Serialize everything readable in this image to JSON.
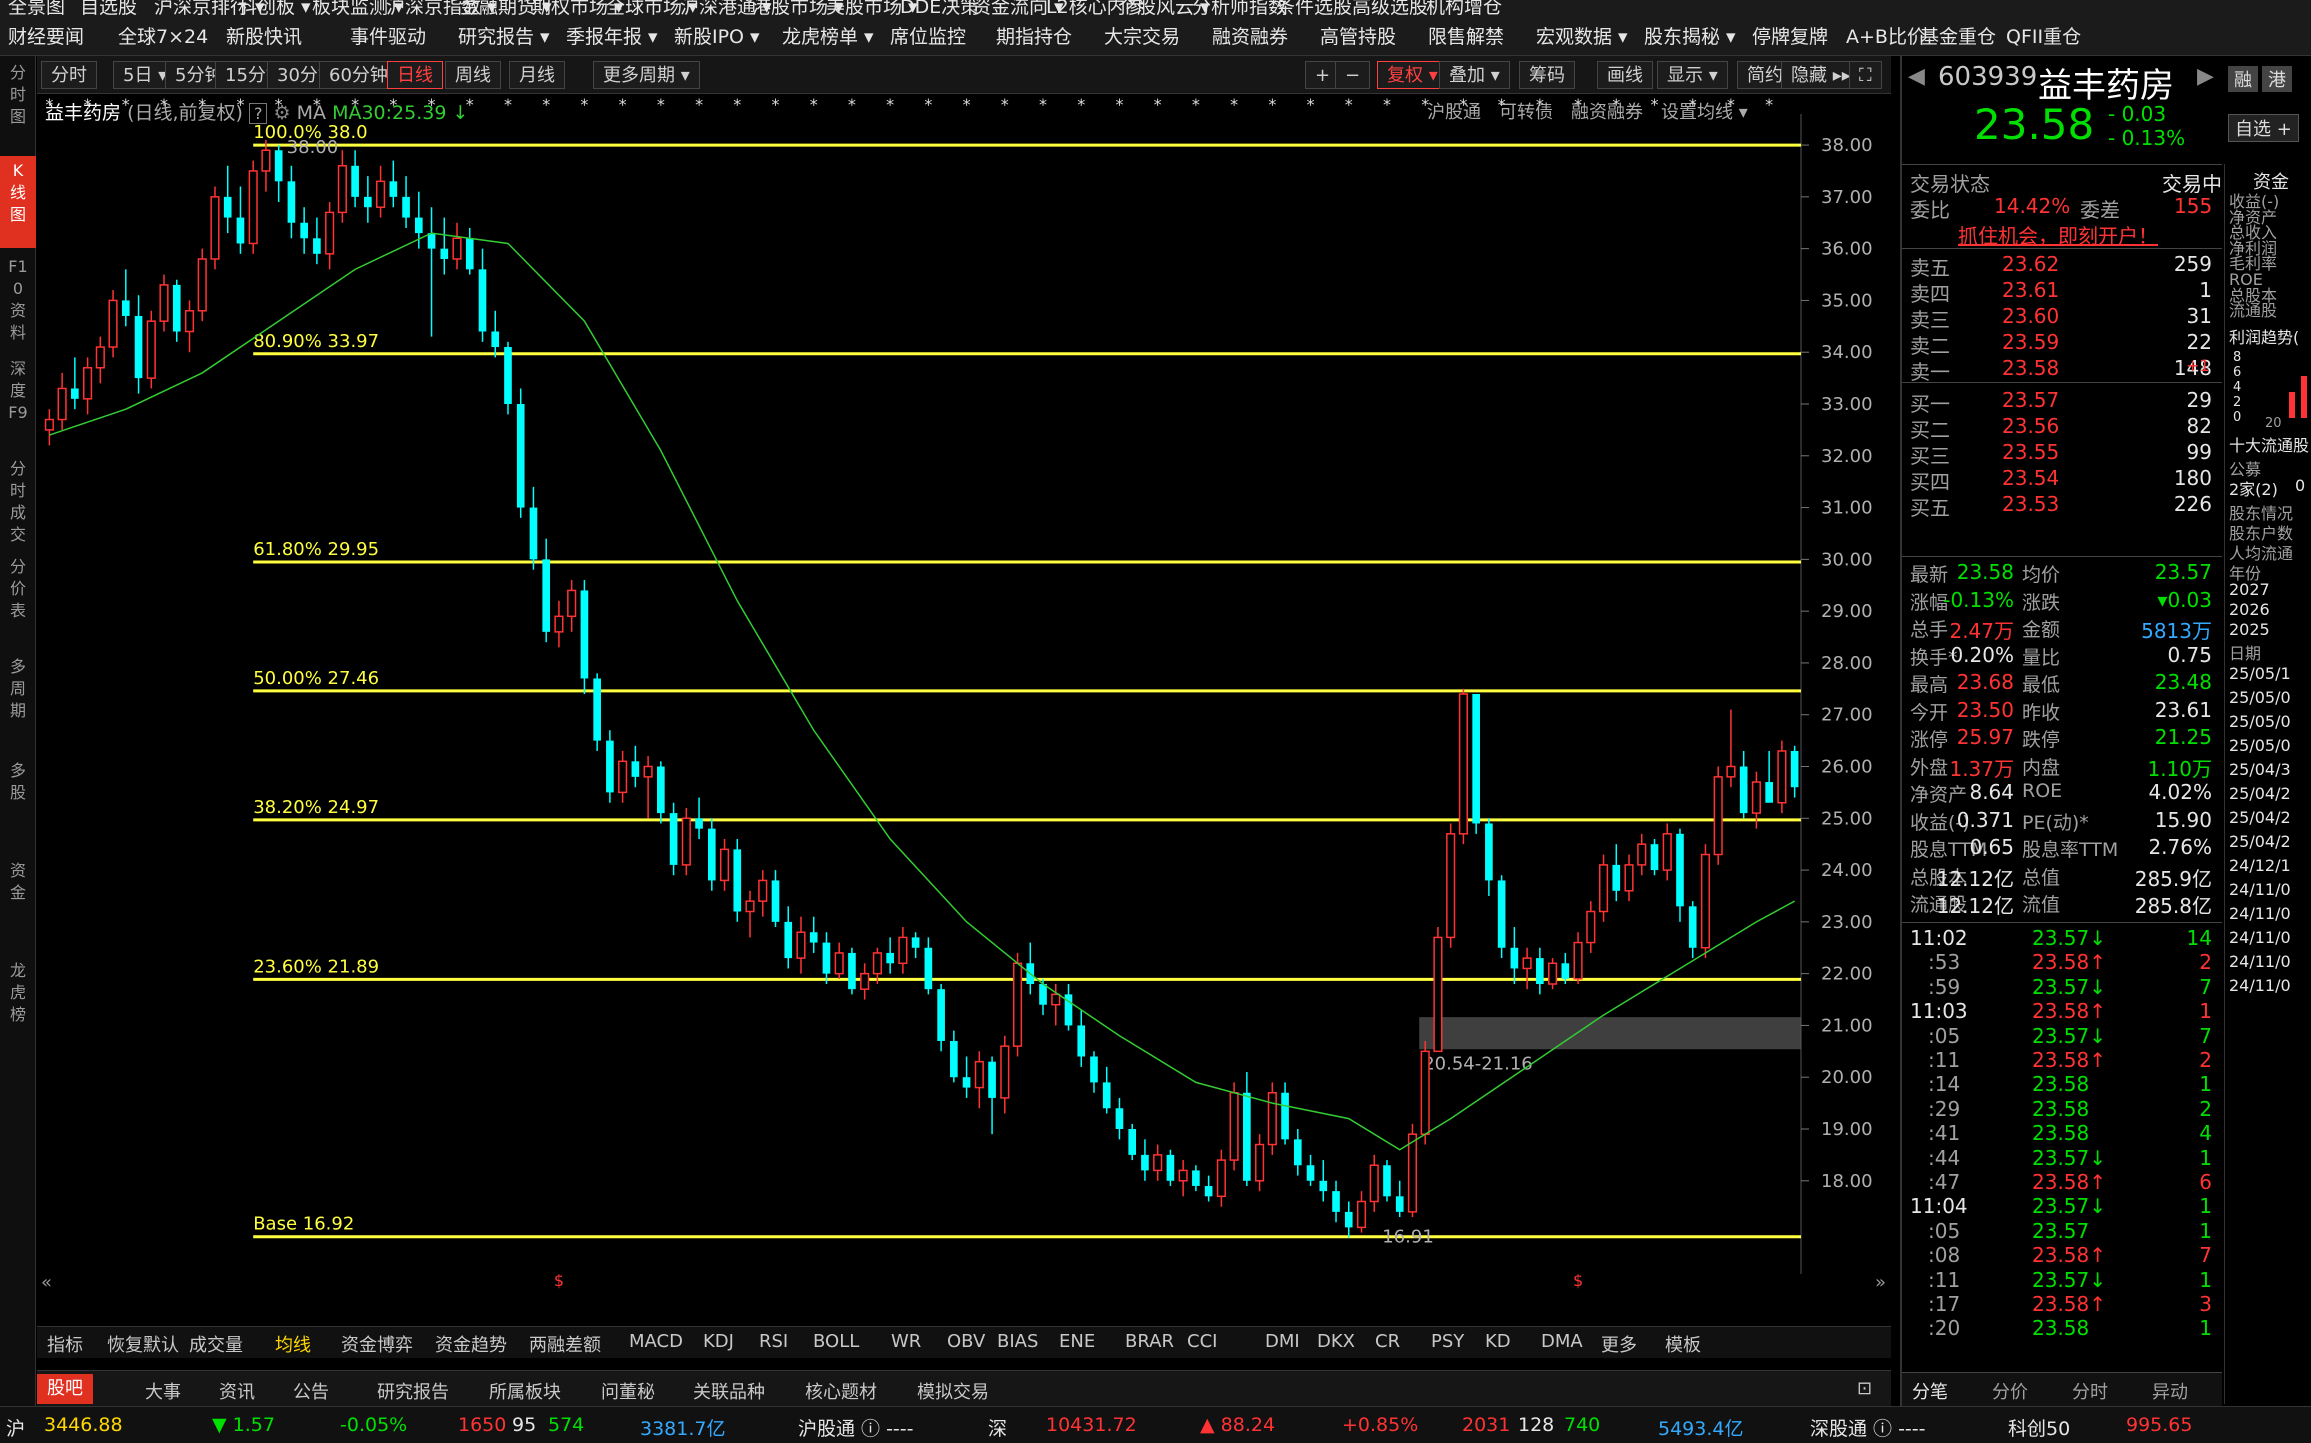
{
  "topnav": {
    "row1": [
      "全景图",
      "自选股",
      "沪深京排行 ▾",
      "科创板 ▾",
      "板块监测 ▾",
      "沪深京指数 ▾",
      "金融期货 ▾",
      "期权市场 ▾",
      "全球市场 ▾",
      "沪深港通 ▾",
      "港股市场 ▾",
      "美股市场 ▾",
      "DDE决策",
      "资金流向 ▾",
      "L2核心内参",
      "个股风云 ▾",
      "分析师指数",
      "条件选股",
      "高级选股",
      "机构增仓"
    ],
    "row2": [
      "财经要闻",
      "全球7×24",
      "新股快讯",
      "事件驱动",
      "研究报告 ▾",
      "季报年报 ▾",
      "新股IPO ▾",
      "龙虎榜单 ▾",
      "席位监控",
      "期指持仓",
      "大宗交易",
      "融资融券",
      "高管持股",
      "限售解禁",
      "宏观数据 ▾",
      "股东揭秘 ▾",
      "停牌复牌",
      "A+B比价",
      "基金重仓",
      "QFII重仓"
    ]
  },
  "leftbar": [
    "分时图",
    "K线图",
    "F10资料",
    "深度F9",
    "分时成交",
    "分价表",
    "多周期",
    "多股",
    "资金",
    "龙虎榜"
  ],
  "toolbar": {
    "periods": [
      "分时",
      "5日 ▾",
      "5分钟",
      "15分钟",
      "30分钟",
      "60分钟",
      "日线",
      "周线",
      "月线",
      "更多周期 ▾"
    ],
    "active_period": "日线",
    "right": [
      "+",
      "−",
      "复权 ▾",
      "叠加 ▾",
      "筹码",
      "画线",
      "显示 ▾",
      "简约",
      "隐藏 ▸▸"
    ]
  },
  "chart_header": {
    "name": "益丰药房",
    "mode": "(日线,前复权)",
    "help": "?",
    "ma_label": "MA",
    "ma30": "MA30:25.39 ↓",
    "links": [
      "沪股通",
      "可转债",
      "融资融券",
      "设置均线 ▾"
    ]
  },
  "chart_data": {
    "type": "candlestick",
    "y_ticks": [
      "38.00",
      "37.00",
      "36.00",
      "35.00",
      "34.00",
      "33.00",
      "32.00",
      "31.00",
      "30.00",
      "29.00",
      "28.00",
      "27.00",
      "26.00",
      "25.00",
      "24.00",
      "23.00",
      "22.00",
      "21.00",
      "20.00",
      "19.00",
      "18.00"
    ],
    "ylim": [
      16.2,
      38.6
    ],
    "fib_levels": [
      {
        "label": "100.0% 38.0",
        "value": 38.0
      },
      {
        "label": "80.90% 33.97",
        "value": 33.97
      },
      {
        "label": "61.80% 29.95",
        "value": 29.95
      },
      {
        "label": "50.00% 27.46",
        "value": 27.46
      },
      {
        "label": "38.20% 24.97",
        "value": 24.97
      },
      {
        "label": "23.60% 21.89",
        "value": 21.89
      },
      {
        "label": "Base   16.92",
        "value": 16.92
      }
    ],
    "peak_label": "38.00",
    "trough_label": "16.91",
    "zone_label": "20.54-21.16",
    "zone": [
      20.54,
      21.16
    ],
    "candles": [
      [
        32.5,
        32.9,
        32.2,
        32.7
      ],
      [
        32.7,
        33.6,
        32.5,
        33.3
      ],
      [
        33.3,
        33.9,
        32.9,
        33.1
      ],
      [
        33.1,
        33.9,
        32.8,
        33.7
      ],
      [
        33.7,
        34.3,
        33.4,
        34.1
      ],
      [
        34.1,
        35.2,
        33.9,
        35.0
      ],
      [
        35.0,
        35.6,
        34.5,
        34.7
      ],
      [
        34.7,
        35.1,
        33.2,
        33.5
      ],
      [
        33.5,
        34.8,
        33.3,
        34.6
      ],
      [
        34.6,
        35.5,
        34.4,
        35.3
      ],
      [
        35.3,
        35.4,
        34.2,
        34.4
      ],
      [
        34.4,
        35.0,
        34.0,
        34.8
      ],
      [
        34.8,
        36.0,
        34.6,
        35.8
      ],
      [
        35.8,
        37.2,
        35.6,
        37.0
      ],
      [
        37.0,
        37.6,
        36.3,
        36.6
      ],
      [
        36.6,
        37.2,
        35.9,
        36.1
      ],
      [
        36.1,
        37.7,
        35.9,
        37.5
      ],
      [
        37.5,
        38.1,
        37.1,
        37.9
      ],
      [
        37.9,
        38.0,
        36.9,
        37.3
      ],
      [
        37.3,
        37.6,
        36.2,
        36.5
      ],
      [
        36.5,
        36.8,
        35.9,
        36.2
      ],
      [
        36.2,
        36.6,
        35.7,
        35.9
      ],
      [
        35.9,
        36.9,
        35.6,
        36.7
      ],
      [
        36.7,
        37.9,
        36.5,
        37.6
      ],
      [
        37.6,
        37.9,
        36.8,
        37.0
      ],
      [
        37.0,
        37.4,
        36.5,
        36.8
      ],
      [
        36.8,
        37.6,
        36.6,
        37.3
      ],
      [
        37.3,
        37.7,
        36.8,
        37.0
      ],
      [
        37.0,
        37.4,
        36.4,
        36.6
      ],
      [
        36.6,
        37.1,
        36.0,
        36.3
      ],
      [
        36.3,
        36.8,
        34.3,
        36.0
      ],
      [
        36.0,
        36.6,
        35.5,
        35.8
      ],
      [
        35.8,
        36.5,
        35.6,
        36.2
      ],
      [
        36.2,
        36.4,
        35.5,
        35.6
      ],
      [
        35.6,
        36.0,
        34.2,
        34.4
      ],
      [
        34.4,
        34.8,
        33.9,
        34.1
      ],
      [
        34.1,
        34.2,
        32.8,
        33.0
      ],
      [
        33.0,
        33.3,
        30.8,
        31.0
      ],
      [
        31.0,
        31.4,
        29.8,
        30.0
      ],
      [
        30.0,
        30.4,
        28.4,
        28.6
      ],
      [
        28.6,
        29.2,
        28.3,
        28.9
      ],
      [
        28.9,
        29.6,
        28.6,
        29.4
      ],
      [
        29.4,
        29.6,
        27.4,
        27.7
      ],
      [
        27.7,
        27.8,
        26.3,
        26.5
      ],
      [
        26.5,
        26.7,
        25.3,
        25.5
      ],
      [
        25.5,
        26.3,
        25.3,
        26.1
      ],
      [
        26.1,
        26.4,
        25.6,
        25.8
      ],
      [
        25.8,
        26.2,
        25.0,
        26.0
      ],
      [
        26.0,
        26.1,
        24.9,
        25.1
      ],
      [
        25.1,
        25.3,
        23.9,
        24.1
      ],
      [
        24.1,
        25.2,
        23.9,
        25.0
      ],
      [
        25.0,
        25.4,
        24.6,
        24.8
      ],
      [
        24.8,
        25.0,
        23.6,
        23.8
      ],
      [
        23.8,
        24.6,
        23.6,
        24.4
      ],
      [
        24.4,
        24.6,
        23.0,
        23.2
      ],
      [
        23.2,
        23.6,
        22.7,
        23.4
      ],
      [
        23.4,
        24.0,
        23.1,
        23.8
      ],
      [
        23.8,
        24.0,
        22.9,
        23.0
      ],
      [
        23.0,
        23.3,
        22.1,
        22.3
      ],
      [
        22.3,
        23.1,
        22.0,
        22.8
      ],
      [
        22.8,
        23.1,
        22.4,
        22.6
      ],
      [
        22.6,
        22.8,
        21.8,
        22.0
      ],
      [
        22.0,
        22.6,
        21.9,
        22.4
      ],
      [
        22.4,
        22.5,
        21.6,
        21.7
      ],
      [
        21.7,
        22.2,
        21.5,
        22.0
      ],
      [
        22.0,
        22.5,
        21.8,
        22.4
      ],
      [
        22.4,
        22.7,
        22.0,
        22.2
      ],
      [
        22.2,
        22.9,
        22.0,
        22.7
      ],
      [
        22.7,
        22.8,
        22.3,
        22.5
      ],
      [
        22.5,
        22.7,
        21.6,
        21.7
      ],
      [
        21.7,
        21.8,
        20.5,
        20.7
      ],
      [
        20.7,
        20.9,
        19.9,
        20.0
      ],
      [
        20.0,
        20.4,
        19.6,
        19.8
      ],
      [
        19.8,
        20.5,
        19.4,
        20.3
      ],
      [
        20.3,
        20.4,
        18.9,
        19.6
      ],
      [
        19.6,
        20.8,
        19.3,
        20.6
      ],
      [
        20.6,
        22.4,
        20.4,
        22.2
      ],
      [
        22.2,
        22.6,
        21.6,
        21.8
      ],
      [
        21.8,
        21.9,
        21.2,
        21.4
      ],
      [
        21.4,
        21.8,
        21.0,
        21.6
      ],
      [
        21.6,
        21.8,
        20.9,
        21.0
      ],
      [
        21.0,
        21.3,
        20.2,
        20.4
      ],
      [
        20.4,
        20.5,
        19.7,
        19.9
      ],
      [
        19.9,
        20.2,
        19.3,
        19.4
      ],
      [
        19.4,
        19.6,
        18.8,
        19.0
      ],
      [
        19.0,
        19.1,
        18.4,
        18.5
      ],
      [
        18.5,
        18.8,
        18.0,
        18.2
      ],
      [
        18.2,
        18.7,
        18.0,
        18.5
      ],
      [
        18.5,
        18.6,
        17.9,
        18.0
      ],
      [
        18.0,
        18.4,
        17.7,
        18.2
      ],
      [
        18.2,
        18.3,
        17.8,
        17.9
      ],
      [
        17.9,
        18.1,
        17.6,
        17.7
      ],
      [
        17.7,
        18.6,
        17.5,
        18.4
      ],
      [
        18.4,
        19.9,
        18.2,
        19.7
      ],
      [
        19.7,
        20.1,
        17.9,
        18.0
      ],
      [
        18.0,
        18.9,
        17.8,
        18.7
      ],
      [
        18.7,
        19.9,
        18.5,
        19.7
      ],
      [
        19.7,
        19.9,
        18.7,
        18.8
      ],
      [
        18.8,
        19.0,
        18.1,
        18.3
      ],
      [
        18.3,
        18.5,
        17.9,
        18.0
      ],
      [
        18.0,
        18.4,
        17.6,
        17.8
      ],
      [
        17.8,
        18.0,
        17.2,
        17.4
      ],
      [
        17.4,
        17.6,
        16.9,
        17.1
      ],
      [
        17.1,
        17.8,
        17.0,
        17.6
      ],
      [
        17.6,
        18.5,
        17.4,
        18.3
      ],
      [
        18.3,
        18.4,
        17.6,
        17.7
      ],
      [
        17.7,
        18.0,
        17.3,
        17.4
      ],
      [
        17.4,
        19.1,
        17.3,
        18.9
      ],
      [
        18.9,
        20.7,
        18.7,
        20.5
      ],
      [
        20.5,
        22.9,
        20.5,
        22.7
      ],
      [
        22.7,
        24.9,
        22.5,
        24.7
      ],
      [
        24.7,
        27.5,
        24.5,
        27.4
      ],
      [
        27.4,
        27.4,
        24.7,
        24.9
      ],
      [
        24.9,
        25.0,
        23.5,
        23.8
      ],
      [
        23.8,
        23.9,
        22.3,
        22.5
      ],
      [
        22.5,
        22.9,
        21.8,
        22.1
      ],
      [
        22.1,
        22.5,
        21.7,
        22.3
      ],
      [
        22.3,
        22.5,
        21.6,
        21.8
      ],
      [
        21.8,
        22.3,
        21.7,
        22.2
      ],
      [
        22.2,
        22.4,
        21.8,
        21.9
      ],
      [
        21.9,
        22.8,
        21.8,
        22.6
      ],
      [
        22.6,
        23.4,
        22.4,
        23.2
      ],
      [
        23.2,
        24.3,
        23.0,
        24.1
      ],
      [
        24.1,
        24.5,
        23.4,
        23.6
      ],
      [
        23.6,
        24.3,
        23.4,
        24.1
      ],
      [
        24.1,
        24.7,
        23.9,
        24.5
      ],
      [
        24.5,
        24.6,
        23.9,
        24.0
      ],
      [
        24.0,
        24.9,
        23.8,
        24.7
      ],
      [
        24.7,
        24.8,
        23.0,
        23.3
      ],
      [
        23.3,
        23.4,
        22.3,
        22.5
      ],
      [
        22.5,
        24.5,
        22.3,
        24.3
      ],
      [
        24.3,
        26.0,
        24.1,
        25.8
      ],
      [
        25.8,
        27.1,
        25.6,
        26.0
      ],
      [
        26.0,
        26.3,
        25.0,
        25.1
      ],
      [
        25.1,
        25.9,
        24.8,
        25.7
      ],
      [
        25.7,
        26.3,
        25.4,
        25.3
      ],
      [
        25.3,
        26.5,
        25.1,
        26.3
      ],
      [
        26.3,
        26.4,
        25.4,
        25.6
      ]
    ],
    "ma30": [
      [
        0,
        32.4
      ],
      [
        6,
        32.9
      ],
      [
        12,
        33.6
      ],
      [
        18,
        34.6
      ],
      [
        24,
        35.6
      ],
      [
        30,
        36.3
      ],
      [
        36,
        36.1
      ],
      [
        42,
        34.6
      ],
      [
        48,
        32.1
      ],
      [
        54,
        29.2
      ],
      [
        60,
        26.7
      ],
      [
        66,
        24.6
      ],
      [
        72,
        23.0
      ],
      [
        78,
        21.8
      ],
      [
        84,
        20.8
      ],
      [
        90,
        19.9
      ],
      [
        96,
        19.5
      ],
      [
        102,
        19.2
      ],
      [
        106,
        18.6
      ],
      [
        110,
        19.2
      ],
      [
        116,
        20.2
      ],
      [
        122,
        21.2
      ],
      [
        128,
        22.1
      ],
      [
        134,
        23.0
      ],
      [
        137,
        23.4
      ]
    ]
  },
  "indicator_tabs": [
    "指标",
    "恢复默认",
    "成交量",
    "均线",
    "资金博弈",
    "资金趋势",
    "两融差额",
    "MACD",
    "KDJ",
    "RSI",
    "BOLL",
    "WR",
    "OBV",
    "BIAS",
    "ENE",
    "BRAR",
    "CCI",
    "DMI",
    "DKX",
    "CR",
    "PSY",
    "KD",
    "DMA",
    "更多",
    "模板"
  ],
  "news_tabs": [
    "股吧",
    "大事",
    "资讯",
    "公告",
    "研究报告",
    "所属板块",
    "问董秘",
    "关联品种",
    "核心题材",
    "模拟交易"
  ],
  "quote": {
    "code": "603939",
    "name": "益丰药房",
    "price": "23.58",
    "change": "- 0.03",
    "pct": "- 0.13%",
    "btn_rong": "融",
    "btn_gang": "港",
    "btn_add": "自选 +",
    "trade_state_label": "交易状态",
    "trade_state": "交易中",
    "weibi_label": "委比",
    "weibi": "14.42%",
    "weicha_label": "委差",
    "weicha": "155",
    "promo": "抓住机会，即刻开户！",
    "asks": [
      [
        "卖五",
        "23.62",
        "259"
      ],
      [
        "卖四",
        "23.61",
        "1"
      ],
      [
        "卖三",
        "23.60",
        "31"
      ],
      [
        "卖二",
        "23.59",
        "22"
      ],
      [
        "卖一",
        "23.58",
        "148"
      ]
    ],
    "ask_note": "+1",
    "bids": [
      [
        "买一",
        "23.57",
        "29"
      ],
      [
        "买二",
        "23.56",
        "82"
      ],
      [
        "买三",
        "23.55",
        "99"
      ],
      [
        "买四",
        "23.54",
        "180"
      ],
      [
        "买五",
        "23.53",
        "226"
      ]
    ],
    "stats": [
      [
        "最新",
        "23.58",
        "均价",
        "23.57"
      ],
      [
        "涨幅",
        "-0.13%",
        "涨跌",
        "▾0.03"
      ],
      [
        "总手",
        "2.47万",
        "金额",
        "5813万"
      ],
      [
        "换手*",
        "0.20%",
        "量比",
        "0.75"
      ],
      [
        "最高",
        "23.68",
        "最低",
        "23.48"
      ],
      [
        "今开",
        "23.50",
        "昨收",
        "23.61"
      ],
      [
        "涨停",
        "25.97",
        "跌停",
        "21.25"
      ],
      [
        "外盘",
        "1.37万",
        "内盘",
        "1.10万"
      ],
      [
        "净资产",
        "8.64",
        "ROE",
        "4.02%"
      ],
      [
        "收益(-)",
        "0.371",
        "PE(动)*",
        "15.90"
      ],
      [
        "股息TTM",
        "0.65",
        "股息率TTM",
        "2.76%"
      ],
      [
        "总股本",
        "12.12亿",
        "总值",
        "285.9亿"
      ],
      [
        "流通股",
        "12.12亿",
        "流值",
        "285.8亿"
      ]
    ],
    "ticks": [
      [
        "11:02",
        "23.57↓",
        "14"
      ],
      [
        ":53",
        "23.58↑",
        "2"
      ],
      [
        ":59",
        "23.57↓",
        "7"
      ],
      [
        "11:03",
        "23.58↑",
        "1"
      ],
      [
        ":05",
        "23.57↓",
        "7"
      ],
      [
        ":11",
        "23.58↑",
        "2"
      ],
      [
        ":14",
        "23.58",
        "1"
      ],
      [
        ":29",
        "23.58",
        "2"
      ],
      [
        ":41",
        "23.58",
        "4"
      ],
      [
        ":44",
        "23.57↓",
        "1"
      ],
      [
        ":47",
        "23.58↑",
        "6"
      ],
      [
        "11:04",
        "23.57↓",
        "1"
      ],
      [
        ":05",
        "23.57",
        "1"
      ],
      [
        ":08",
        "23.58↑",
        "7"
      ],
      [
        ":11",
        "23.57↓",
        "1"
      ],
      [
        ":17",
        "23.58↑",
        "3"
      ],
      [
        ":20",
        "23.58",
        "1"
      ]
    ],
    "tick_tabs": [
      "分笔",
      "分价",
      "分时",
      "异动"
    ],
    "side_header": "资金",
    "side_items": [
      "收益(-)",
      "净资产",
      "总收入",
      "净利润",
      "毛利率",
      "ROE",
      "总股本",
      "流通股"
    ],
    "side_trend": "利润趋势(",
    "side_chart_ticks": [
      "8",
      "6",
      "4",
      "2",
      "0"
    ],
    "side_chart_x": "20",
    "side_top10": "十大流通股",
    "side_gongmu": "公募",
    "side_jia": "2家(2)",
    "side_jia2": "0",
    "side_gudong": [
      "股东情况",
      "股东户数",
      "人均流通"
    ],
    "side_year_hdr": "年份",
    "side_years": [
      "2027",
      "2026",
      "2025"
    ],
    "side_date_hdr": "日期",
    "side_dates": [
      "25/05/1",
      "25/05/0",
      "25/05/0",
      "25/05/0",
      "25/04/3",
      "25/04/2",
      "25/04/2",
      "25/04/2",
      "24/12/1",
      "24/11/0",
      "24/11/0",
      "24/11/0",
      "24/11/0",
      "24/11/0"
    ]
  },
  "status": {
    "sh_label": "沪",
    "sh": "3446.88",
    "sh_chg": "▼ 1.57",
    "sh_pct": "-0.05%",
    "sh_up": "1650",
    "sh_flat": "95",
    "sh_down": "574",
    "sh_amt": "3381.7亿",
    "hgt": "沪股通 ⓘ ----",
    "sz_label": "深",
    "sz": "10431.72",
    "sz_chg": "▲ 88.24",
    "sz_pct": "+0.85%",
    "sz_up": "2031",
    "sz_flat": "128",
    "sz_down": "740",
    "sz_amt": "5493.4亿",
    "sgt": "深股通 ⓘ ----",
    "kc_label": "科创50",
    "kc": "995.65"
  },
  "colors": {
    "up": "#ff3333",
    "down": "#00ffff",
    "fib": "#ffff40",
    "ma": "#33cc33",
    "accent": "#e03020"
  }
}
